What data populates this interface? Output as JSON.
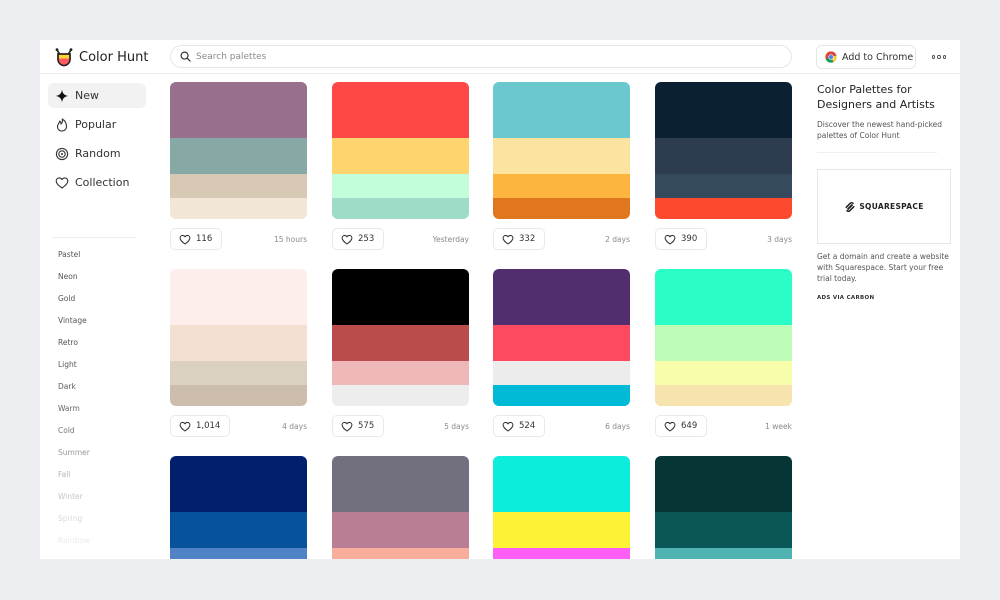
{
  "header": {
    "logo_text": "Color Hunt",
    "search_placeholder": "Search palettes",
    "chrome_label": "Add to Chrome"
  },
  "sidebar": {
    "nav": [
      {
        "label": "New",
        "icon": "sparkle-icon",
        "active": true
      },
      {
        "label": "Popular",
        "icon": "flame-icon",
        "active": false
      },
      {
        "label": "Random",
        "icon": "random-icon",
        "active": false
      },
      {
        "label": "Collection",
        "icon": "heart-icon",
        "active": false
      }
    ],
    "tags": [
      "Pastel",
      "Neon",
      "Gold",
      "Vintage",
      "Retro",
      "Light",
      "Dark",
      "Warm",
      "Cold",
      "Summer",
      "Fall",
      "Winter",
      "Spring",
      "Rainbow"
    ]
  },
  "palettes": [
    {
      "colors": [
        "#98708d",
        "#86a9a6",
        "#d8c9b5",
        "#f2e6d6"
      ],
      "likes": "116",
      "time": "15 hours"
    },
    {
      "colors": [
        "#fe4848",
        "#fed46e",
        "#c1fed9",
        "#9fdcc7"
      ],
      "likes": "253",
      "time": "Yesterday"
    },
    {
      "colors": [
        "#6bc8ce",
        "#fde3a0",
        "#feb53f",
        "#e0771f"
      ],
      "likes": "332",
      "time": "2 days"
    },
    {
      "colors": [
        "#0c2033",
        "#2e3c4f",
        "#354a5d",
        "#fd4a2e"
      ],
      "likes": "390",
      "time": "3 days"
    },
    {
      "colors": [
        "#feeeeb",
        "#f4e0d2",
        "#dad1c0",
        "#cdbdac"
      ],
      "likes": "1,014",
      "time": "4 days"
    },
    {
      "colors": [
        "#000000",
        "#bb4c4c",
        "#efb8b8",
        "#ededed"
      ],
      "likes": "575",
      "time": "5 days"
    },
    {
      "colors": [
        "#532e6e",
        "#fd4a60",
        "#ececec",
        "#00bad6"
      ],
      "likes": "524",
      "time": "6 days"
    },
    {
      "colors": [
        "#2bfdc6",
        "#bdfcb6",
        "#f7fdab",
        "#f7e3ae"
      ],
      "likes": "649",
      "time": "1 week"
    },
    {
      "colors": [
        "#021f6e",
        "#06539c",
        "#4f83c6",
        "#8fb3e0"
      ],
      "likes": "",
      "time": ""
    },
    {
      "colors": [
        "#72707f",
        "#b97d95",
        "#f8ae9b",
        "#fde1cf"
      ],
      "likes": "",
      "time": ""
    },
    {
      "colors": [
        "#0deddc",
        "#fdf334",
        "#fd5ff4",
        "#ffd0f6"
      ],
      "likes": "",
      "time": ""
    },
    {
      "colors": [
        "#053535",
        "#0a5758",
        "#4fb3b2",
        "#a9dedb"
      ],
      "likes": "",
      "time": ""
    }
  ],
  "panel": {
    "title": "Color Palettes for Designers and Artists",
    "description": "Discover the newest hand-picked palettes of Color Hunt",
    "ad_brand": "SQUARESPACE",
    "ad_text": "Get a domain and create a website with Squarespace. Start your free trial today.",
    "ad_via": "ADS VIA CARBON"
  }
}
